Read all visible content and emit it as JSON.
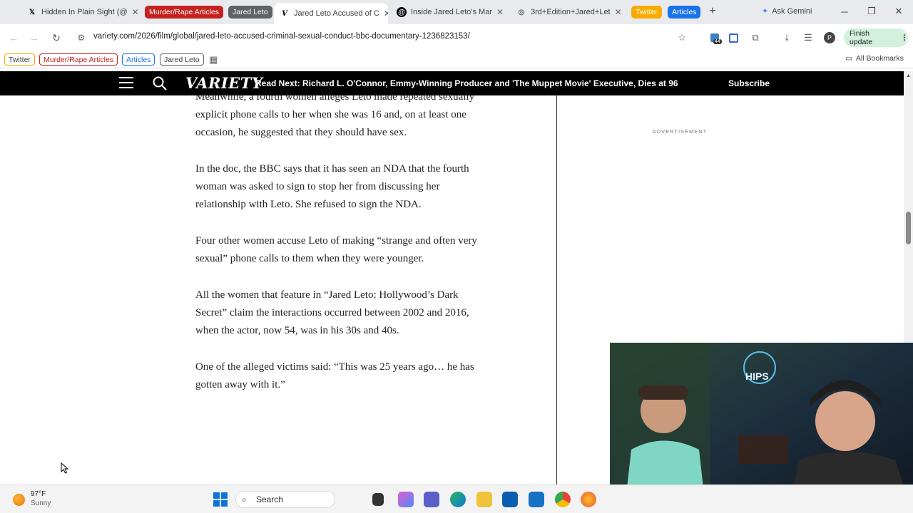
{
  "tabs": [
    {
      "label": "Hidden In Plain Sight (@",
      "icon": "x-logo-icon"
    },
    {
      "label": "Jared Leto Accused of C",
      "icon": "variety-v-icon",
      "active": true
    },
    {
      "label": "Inside Jared Leto's Mar",
      "icon": "threads-icon"
    },
    {
      "label": "3rd+Edition+Jared+Let",
      "icon": "globe-icon"
    }
  ],
  "tab_groups": {
    "murder": "Murder/Rape Articles",
    "jared": "Jared Leto",
    "twitter": "Twitter",
    "articles": "Articles"
  },
  "ask_gemini": "Ask Gemini",
  "url": "variety.com/2026/film/global/jared-leto-accused-criminal-sexual-conduct-bbc-documentary-1236823153/",
  "extension_badge": "44",
  "profile_initial": "P",
  "finish_update": "Finish update",
  "bookmarks": {
    "twitter": "Twitter",
    "murder": "Murder/Rape Articles",
    "articles": "Articles",
    "jared": "Jared Leto",
    "all": "All Bookmarks"
  },
  "site": {
    "logo": "VARIETY",
    "read_next": "Read Next: Richard L. O'Connor, Emmy-Winning Producer and 'The Muppet Movie' Executive, Dies at 96",
    "subscribe": "Subscribe",
    "ad_label": "ADVERTISEMENT"
  },
  "article": {
    "p1": "Meanwhile, a fourth women alleges Leto made repeated sexually explicit phone calls to her when she was 16 and, on at least one occasion, he suggested that they should have sex.",
    "p2": "In the doc, the BBC says that it has seen an NDA that the fourth woman was asked to sign to stop her from discussing her relationship with Leto. She refused to sign the NDA.",
    "p3": "Four other women accuse Leto of making “strange and often very sexual” phone calls to them when they were younger.",
    "p4": "All the women that feature in “Jared Leto: Hollywood’s Dark Secret” claim the interactions occurred between 2002 and 2016, when the actor, now 54, was in his 30s and 40s.",
    "p5": "One of the alleged victims said: “This was 25 years ago… he has gotten away with it.”"
  },
  "webcam": {
    "neon_sign": "HIPS"
  },
  "taskbar": {
    "temp": "97°F",
    "weather": "Sunny",
    "search": "Search"
  },
  "colors": {
    "murder_group": "#c5221f",
    "jared_group": "#5f6368",
    "twitter_group": "#f9ab00",
    "articles_group": "#1a73e8",
    "finish_update_bg": "#d3f0dc"
  }
}
